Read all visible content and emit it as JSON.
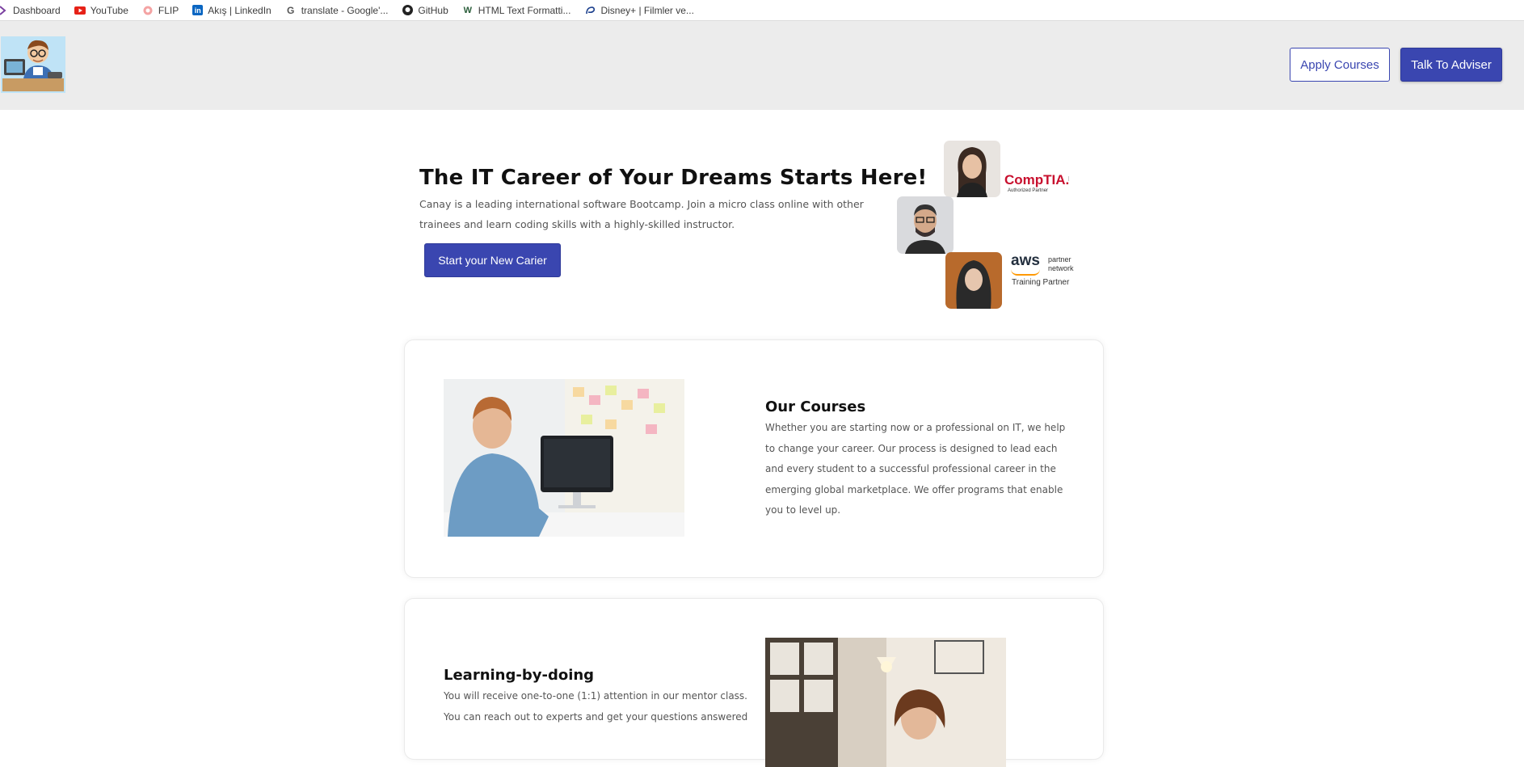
{
  "bookmarks": [
    {
      "label": "Dashboard",
      "icon": "dashboard-icon"
    },
    {
      "label": "YouTube",
      "icon": "youtube-icon"
    },
    {
      "label": "FLIP",
      "icon": "flip-icon"
    },
    {
      "label": "Akış | LinkedIn",
      "icon": "linkedin-icon"
    },
    {
      "label": "translate - Google'...",
      "icon": "google-icon"
    },
    {
      "label": "GitHub",
      "icon": "github-icon"
    },
    {
      "label": "HTML Text Formatti...",
      "icon": "w3-icon"
    },
    {
      "label": "Disney+ | Filmler ve...",
      "icon": "disney-icon"
    }
  ],
  "header": {
    "apply_label": "Apply Courses",
    "adviser_label": "Talk To Adviser"
  },
  "hero": {
    "title": "The IT Career of Your Dreams Starts Here!",
    "text": "Canay is a leading international software Bootcamp. Join a micro class online with other trainees and learn coding skills with a highly-skilled instructor.",
    "cta": "Start your New Carier",
    "comptia": "CompTIA.",
    "comptia_sub": "Authorized Partner",
    "aws": "aws",
    "aws_partner": "partner network",
    "aws_training": "Training Partner"
  },
  "courses": {
    "title": "Our Courses",
    "text": "Whether you are starting now or a professional on IT, we help to change your career. Our process is designed to lead each and every student to a successful professional career in the emerging global marketplace. We offer programs that enable you to level up."
  },
  "learning": {
    "title": "Learning-by-doing",
    "text": "You will receive one-to-one (1:1) attention in our mentor class. You can reach out to experts and get your questions answered"
  },
  "colors": {
    "primary": "#3a46b0",
    "header_bg": "#ececec"
  }
}
